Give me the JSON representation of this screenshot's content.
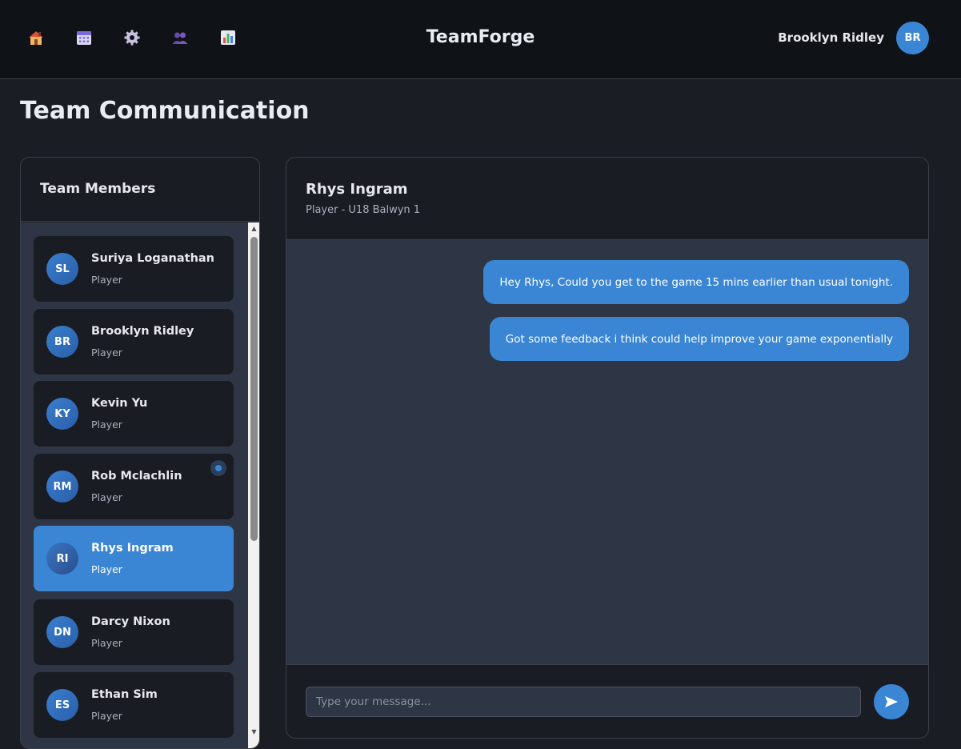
{
  "app": {
    "title": "TeamForge"
  },
  "nav": [
    {
      "name": "home-icon"
    },
    {
      "name": "calendar-icon"
    },
    {
      "name": "gear-icon"
    },
    {
      "name": "team-icon"
    },
    {
      "name": "stats-icon"
    }
  ],
  "user": {
    "name": "Brooklyn Ridley",
    "initials": "BR"
  },
  "page": {
    "title": "Team Communication"
  },
  "members": {
    "heading": "Team Members",
    "items": [
      {
        "initials": "SL",
        "name": "Suriya Loganathan",
        "role": "Player"
      },
      {
        "initials": "BR",
        "name": "Brooklyn Ridley",
        "role": "Player"
      },
      {
        "initials": "KY",
        "name": "Kevin Yu",
        "role": "Player"
      },
      {
        "initials": "RM",
        "name": "Rob Mclachlin",
        "role": "Player"
      },
      {
        "initials": "RI",
        "name": "Rhys Ingram",
        "role": "Player"
      },
      {
        "initials": "DN",
        "name": "Darcy Nixon",
        "role": "Player"
      },
      {
        "initials": "ES",
        "name": "Ethan Sim",
        "role": "Player"
      }
    ]
  },
  "chat": {
    "name": "Rhys Ingram",
    "subtitle": "Player - U18 Balwyn 1",
    "messages": [
      "Hey Rhys, Could you get to the game 15 mins earlier than usual tonight.",
      "Got some feedback i think could help improve your game exponentially"
    ],
    "placeholder": "Type your message...",
    "accent": "#3a86d4"
  }
}
